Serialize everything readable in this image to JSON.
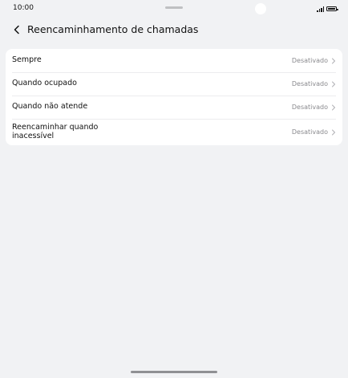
{
  "status_bar": {
    "time": "10:00",
    "icons": [
      "signal-icon",
      "battery-icon"
    ]
  },
  "header": {
    "back_icon": "chevron-left-icon",
    "title": "Reencaminhamento de chamadas"
  },
  "settings": {
    "rows": [
      {
        "label": "Sempre",
        "value": "Desativado"
      },
      {
        "label": "Quando ocupado",
        "value": "Desativado"
      },
      {
        "label": "Quando não atende",
        "value": "Desativado"
      },
      {
        "label": "Reencaminhar quando\ninacessível",
        "value": "Desativado"
      }
    ]
  },
  "colors": {
    "background": "#f1f2f4",
    "card": "#ffffff",
    "secondary_text": "#8a8a8e"
  }
}
